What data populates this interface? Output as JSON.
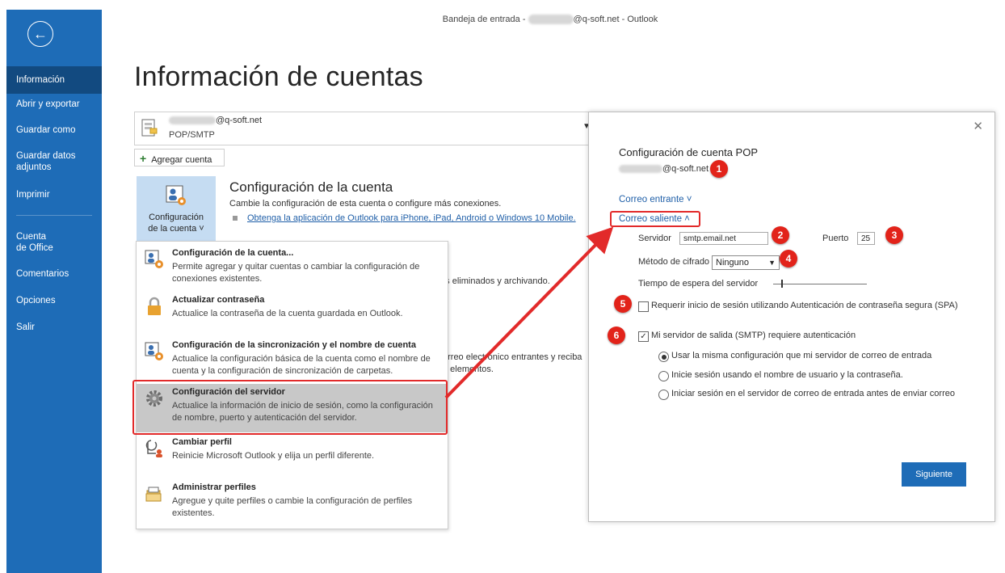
{
  "titlebar": {
    "prefix": "Bandeja de entrada -",
    "suffix": "@q-soft.net  -  Outlook"
  },
  "sidebar": {
    "items": [
      {
        "label": "Información"
      },
      {
        "label": "Abrir y exportar"
      },
      {
        "label": "Guardar como"
      },
      {
        "label": "Guardar datos\nadjuntos"
      },
      {
        "label": "Imprimir"
      },
      {
        "label": "Cuenta\nde Office"
      },
      {
        "label": "Comentarios"
      },
      {
        "label": "Opciones"
      },
      {
        "label": "Salir"
      }
    ]
  },
  "page": {
    "title": "Información de cuentas"
  },
  "account": {
    "email_suffix": "@q-soft.net",
    "type": "POP/SMTP"
  },
  "add_account": "Agregar cuenta",
  "config_tile": {
    "label": "Configuración\nde la cuenta ˅"
  },
  "section": {
    "title": "Configuración de la cuenta",
    "desc": "Cambie la configuración de esta cuenta o configure más conexiones.",
    "link": "Obtenga la aplicación de Outlook para iPhone, iPad, Android o Windows 10 Mobile."
  },
  "background_text": {
    "line1": "tos eliminados y archivando.",
    "line2": "orreo electrónico entrantes y reciba",
    "line3": "n elementos."
  },
  "menu": {
    "items": [
      {
        "title": "Configuración de la cuenta...",
        "desc": "Permite agregar y quitar cuentas o cambiar la configuración de conexiones existentes."
      },
      {
        "title": "Actualizar contraseña",
        "desc": "Actualice la contraseña de la cuenta guardada en Outlook."
      },
      {
        "title": "Configuración de la sincronización y el nombre de cuenta",
        "desc": "Actualice la configuración básica de la cuenta como el nombre de cuenta y la configuración de sincronización de carpetas."
      },
      {
        "title": "Configuración del servidor",
        "desc": "Actualice la información de inicio de sesión, como la configuración de nombre, puerto y autenticación del servidor."
      },
      {
        "title": "Cambiar perfil",
        "desc": "Reinicie Microsoft Outlook y elija un perfil diferente."
      },
      {
        "title": "Administrar perfiles",
        "desc": "Agregue y quite perfiles o cambie la configuración de perfiles existentes."
      }
    ]
  },
  "dialog": {
    "title": "Configuración de cuenta POP",
    "email_suffix": "@q-soft.net",
    "incoming": "Correo entrante  ˅",
    "outgoing": "Correo saliente  ˄",
    "server_label": "Servidor",
    "server_value": "smtp.email.net",
    "port_label": "Puerto",
    "port_value": "25",
    "encryption_label": "Método de cifrado",
    "encryption_value": "Ninguno",
    "timeout_label": "Tiempo de espera del servidor",
    "spa_label": "Requerir inicio de sesión utilizando Autenticación de contraseña segura (SPA)",
    "spa_checked": false,
    "smtp_auth_label": "Mi servidor de salida (SMTP) requiere autenticación",
    "smtp_auth_checked": true,
    "radio_options": [
      {
        "label": "Usar la misma configuración que mi servidor de correo de entrada",
        "selected": true
      },
      {
        "label": "Inicie sesión usando el nombre de usuario y la contraseña.",
        "selected": false
      },
      {
        "label": "Iniciar sesión en el servidor de correo de entrada antes de enviar correo",
        "selected": false
      }
    ],
    "next_button": "Siguiente"
  },
  "badges": [
    "1",
    "2",
    "3",
    "4",
    "5",
    "6"
  ],
  "colors": {
    "sidebar": "#1e6cb7",
    "sidebar_active": "#124a80",
    "highlight": "#e22a2a",
    "link": "#1f5fa8"
  }
}
